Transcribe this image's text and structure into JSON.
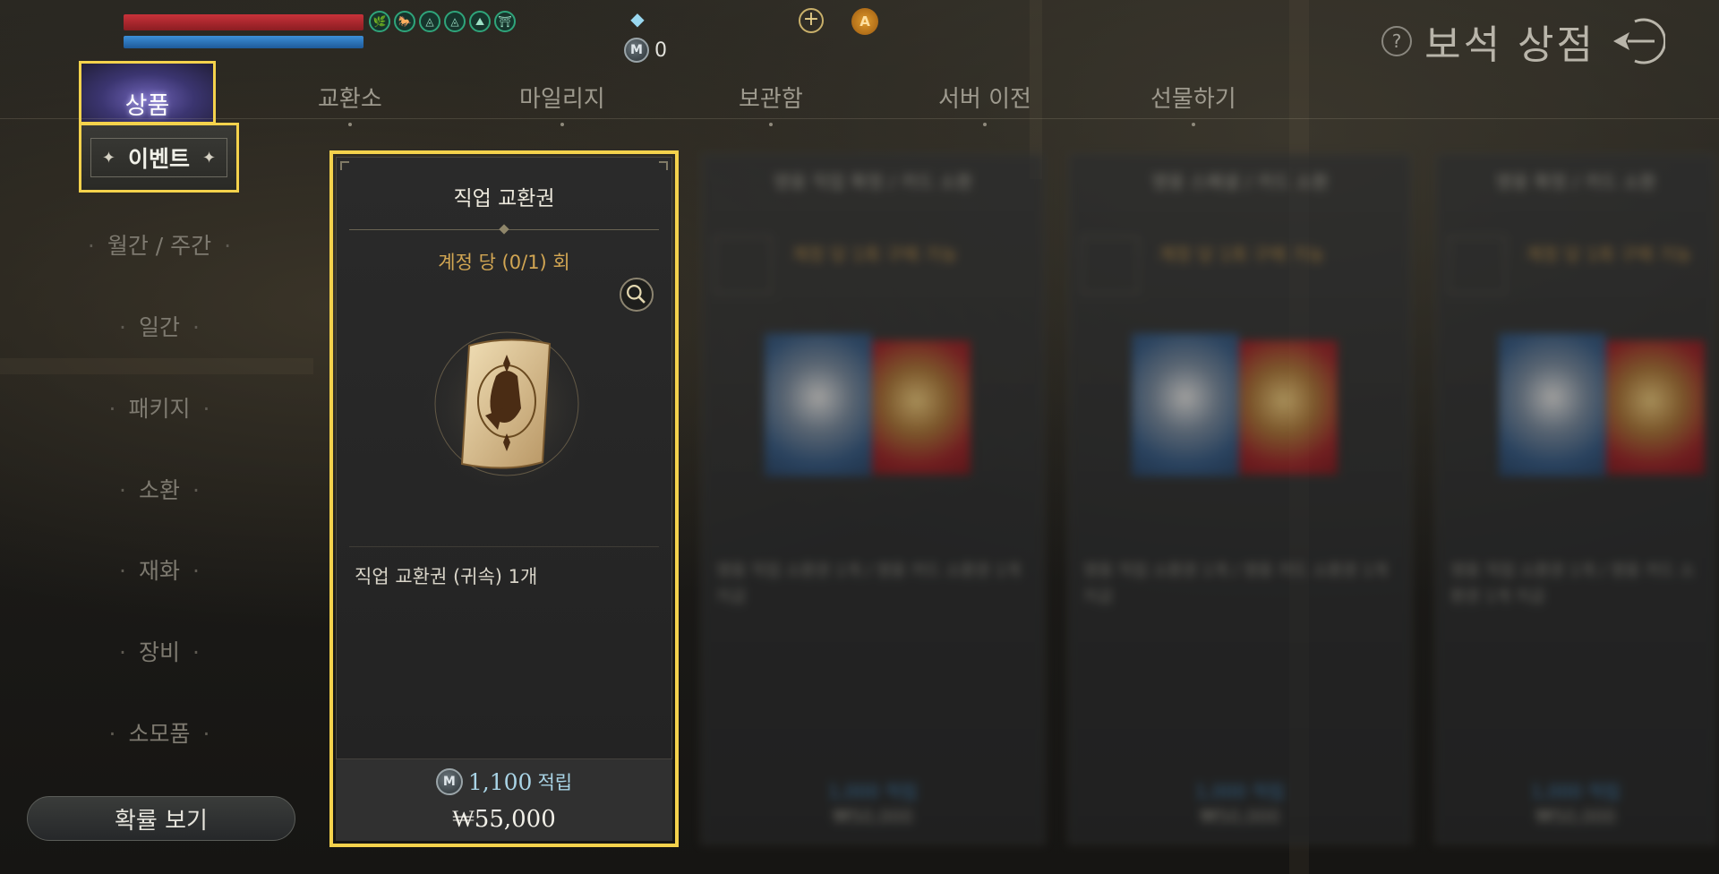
{
  "hud": {
    "mileage_value": "0",
    "mileage_icon": "M",
    "badge_letter": "A",
    "buffs": [
      "🌿",
      "🐎",
      "◬",
      "◬",
      "⛰",
      "⛩"
    ]
  },
  "store": {
    "title": "보석 상점",
    "help_symbol": "?"
  },
  "tabs": {
    "active": "상품",
    "items": [
      "교환소",
      "마일리지",
      "보관함",
      "서버 이전",
      "선물하기"
    ]
  },
  "sidebar": {
    "active": "이벤트",
    "items": [
      "월간 / 주간",
      "일간",
      "패키지",
      "소환",
      "재화",
      "장비",
      "소모품"
    ],
    "probability_button": "확률 보기"
  },
  "featured_card": {
    "title": "직업 교환권",
    "limit": "계정 당 (0/1) 회",
    "description": "직업 교환권 (귀속) 1개",
    "points": "1,100",
    "points_label": "적립",
    "price": "₩55,000"
  },
  "blurred_cards": [
    {
      "title": "영웅 직업 확정 / 카드 소환",
      "limit": "계정 당 1회 구매 가능",
      "desc": "영웅 직업 소환권 1개 / 영웅 카드 소환권 1개 지급",
      "points": "1,000 적립",
      "price": "₩50,000"
    },
    {
      "title": "영웅 스페셜 / 카드 소환",
      "limit": "계정 당 1회 구매 가능",
      "desc": "영웅 직업 소환권 1개 / 영웅 카드 소환권 1개 지급",
      "points": "1,000 적립",
      "price": "₩50,000"
    },
    {
      "title": "영웅 확정 / 카드 소환",
      "limit": "계정 당 1회 구매 가능",
      "desc": "영웅 직업 소환권 1개 / 영웅 카드 소환권 1개 지급",
      "points": "1,000 적립",
      "price": "₩50,000"
    }
  ],
  "colors": {
    "highlight": "#f4d24c",
    "hp": "#c8323a",
    "mp": "#3c8fd8",
    "limit_text": "#d2a653",
    "points_text": "#a9d4e6"
  },
  "icons": [
    "gem-icon",
    "mileage-coin-icon",
    "plus-icon",
    "badge-icon",
    "help-icon",
    "back-arrow-icon",
    "zoom-icon",
    "scroll-icon"
  ]
}
